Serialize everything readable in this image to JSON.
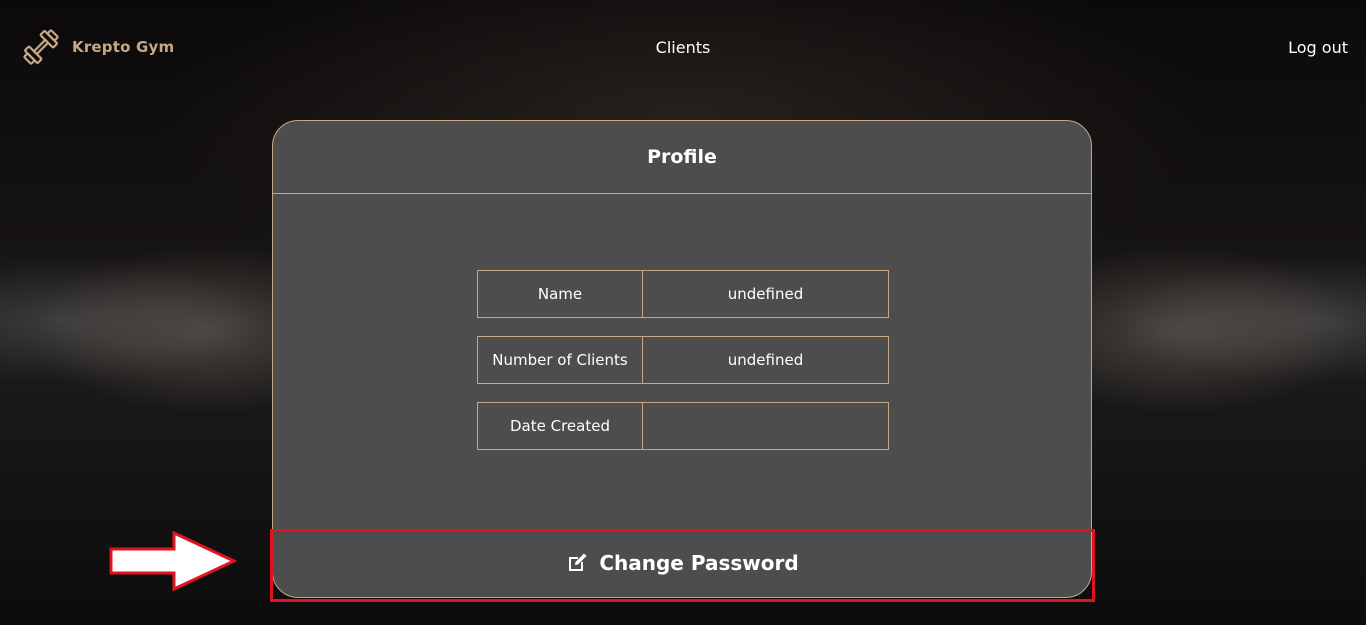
{
  "header": {
    "logo_text": "Krepto Gym",
    "logo_icon": "dumbbell-icon",
    "nav_clients": "Clients",
    "nav_logout": "Log out"
  },
  "profile": {
    "title": "Profile",
    "rows": [
      {
        "label": "Name",
        "value": "undefined"
      },
      {
        "label": "Number of Clients",
        "value": "undefined"
      },
      {
        "label": "Date Created",
        "value": ""
      }
    ],
    "change_password_label": "Change Password",
    "change_password_icon": "edit-icon"
  },
  "colors": {
    "accent": "#c7a784",
    "card_bg": "#4d4d4d",
    "highlight": "#e0141e"
  }
}
